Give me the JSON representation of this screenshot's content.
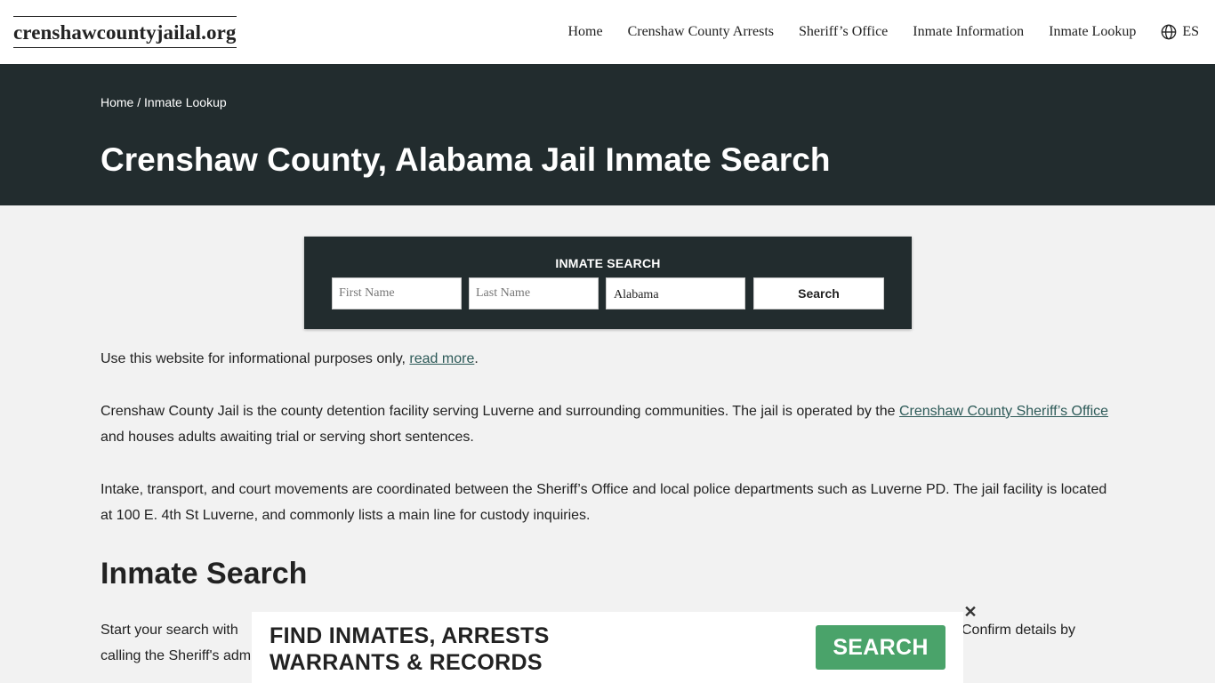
{
  "header": {
    "logo": "crenshawcountyjailal.org",
    "nav": [
      "Home",
      "Crenshaw County Arrests",
      "Sheriff’s Office",
      "Inmate Information",
      "Inmate Lookup"
    ],
    "lang_label": "ES"
  },
  "hero": {
    "breadcrumb_home": "Home",
    "breadcrumb_sep": " / ",
    "breadcrumb_current": "Inmate Lookup",
    "title": "Crenshaw County, Alabama Jail Inmate Search"
  },
  "search": {
    "title": "INMATE SEARCH",
    "first_name_placeholder": "First Name",
    "last_name_placeholder": "Last Name",
    "state_value": "Alabama",
    "button_label": "Search"
  },
  "content": {
    "p1_text": "Use this website for informational purposes only, ",
    "p1_link": "read more",
    "p1_end": ".",
    "p2_text": "Crenshaw County Jail is the county detention facility serving Luverne and surrounding communities. The jail is operated by the ",
    "p2_link": "Crenshaw County Sheriff’s Office",
    "p2_end": " and houses adults awaiting trial or serving short sentences.",
    "p3_text": "Intake, transport, and court movements are coordinated between the Sheriff’s Office and local police departments such as Luverne PD. The jail facility is located at 100 E. 4th St Luverne, and commonly lists a main line for custody inquiries.",
    "h2": "Inmate Search",
    "p4_start": "Start your search with",
    "p4_end": "Confirm details by",
    "p4_line2": "calling the Sheriff's adm"
  },
  "ad": {
    "line1": "FIND INMATES, ARRESTS",
    "line2": "WARRANTS & RECORDS",
    "button_label": "SEARCH",
    "close": "✕"
  },
  "colors": {
    "hero_bg": "#222c2e",
    "link": "#2d5a58",
    "ad_button": "#4aa36a"
  }
}
